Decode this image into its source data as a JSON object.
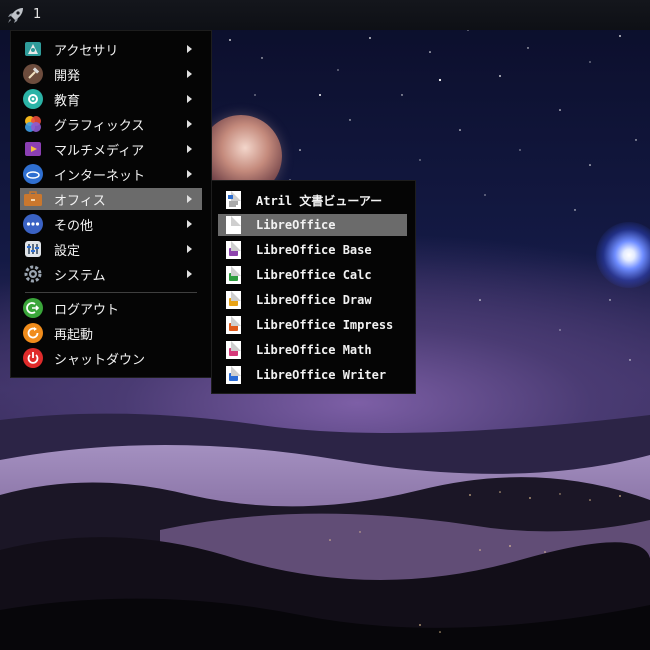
{
  "panel": {
    "launcher_icon": "rocket-icon",
    "workspace": "1"
  },
  "main_menu": {
    "items": [
      {
        "label": "アクセサリ",
        "icon": "accessories-icon",
        "submenu": true
      },
      {
        "label": "開発",
        "icon": "development-hammer-icon",
        "submenu": true
      },
      {
        "label": "教育",
        "icon": "education-icon",
        "submenu": true
      },
      {
        "label": "グラフィックス",
        "icon": "graphics-icon",
        "submenu": true
      },
      {
        "label": "マルチメディア",
        "icon": "multimedia-icon",
        "submenu": true
      },
      {
        "label": "インターネット",
        "icon": "internet-icon",
        "submenu": true
      },
      {
        "label": "オフィス",
        "icon": "office-briefcase-icon",
        "submenu": true,
        "active": true
      },
      {
        "label": "その他",
        "icon": "other-icon",
        "submenu": true
      },
      {
        "label": "設定",
        "icon": "settings-icon",
        "submenu": true
      },
      {
        "label": "システム",
        "icon": "system-gear-icon",
        "submenu": true
      }
    ],
    "session": [
      {
        "label": "ログアウト",
        "icon": "logout-icon"
      },
      {
        "label": "再起動",
        "icon": "reboot-icon"
      },
      {
        "label": "シャットダウン",
        "icon": "shutdown-icon"
      }
    ]
  },
  "office_submenu": {
    "items": [
      {
        "label": "Atril 文書ビューアー",
        "icon": "atril-document-viewer-icon"
      },
      {
        "label": "LibreOffice",
        "icon": "libreoffice-icon",
        "active": true
      },
      {
        "label": "LibreOffice Base",
        "icon": "libreoffice-base-icon"
      },
      {
        "label": "LibreOffice Calc",
        "icon": "libreoffice-calc-icon"
      },
      {
        "label": "LibreOffice Draw",
        "icon": "libreoffice-draw-icon"
      },
      {
        "label": "LibreOffice Impress",
        "icon": "libreoffice-impress-icon"
      },
      {
        "label": "LibreOffice Math",
        "icon": "libreoffice-math-icon"
      },
      {
        "label": "LibreOffice Writer",
        "icon": "libreoffice-writer-icon"
      }
    ]
  },
  "colors": {
    "menu_bg": "#050505",
    "highlight": "#6b6b6b",
    "base": "#8e44ad",
    "calc": "#2e9c3f",
    "draw": "#e8a317",
    "impress": "#e05a1b",
    "math": "#d63a7a",
    "writer": "#2b6cd6"
  }
}
